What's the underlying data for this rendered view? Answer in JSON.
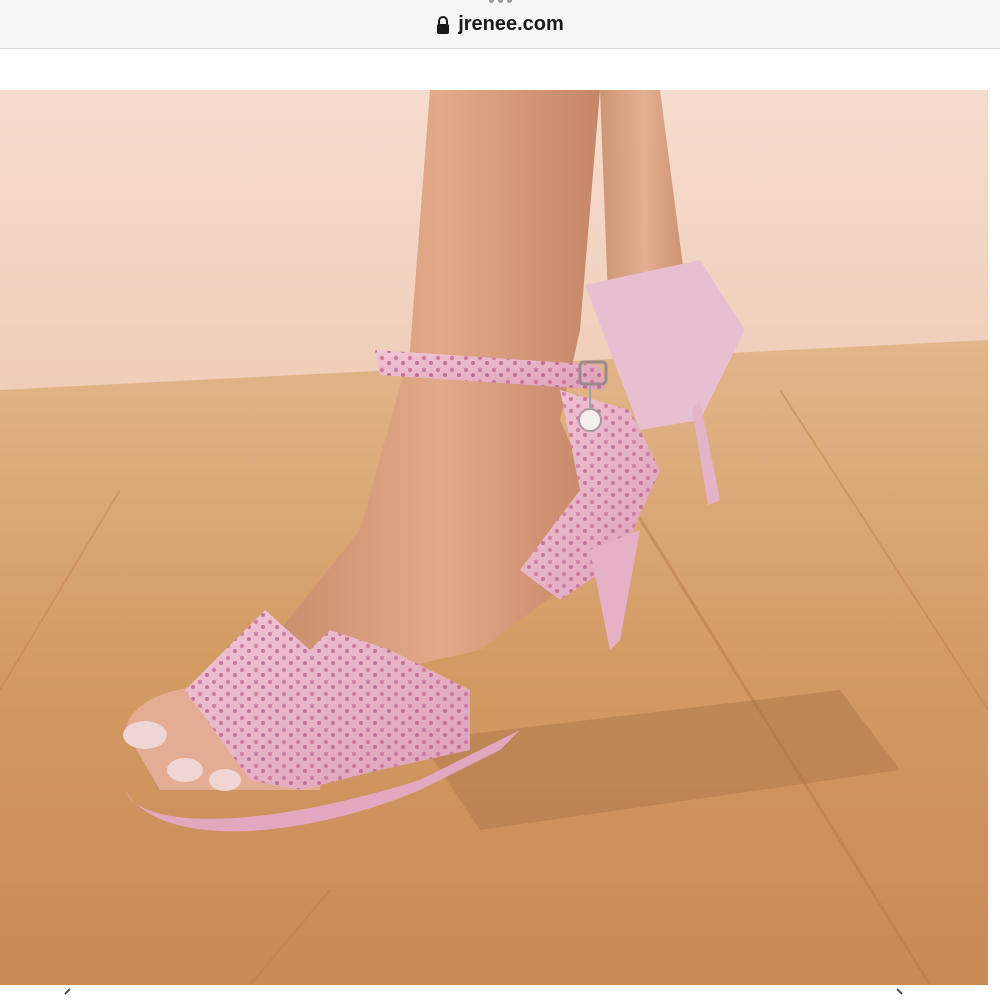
{
  "browser": {
    "url": "jrenee.com",
    "lock_icon": "lock-icon"
  },
  "photo": {
    "icon": "product-photo"
  },
  "colors": {
    "wall": "#f2d4c4",
    "floor": "#d9a26c",
    "shoe": "#e9b3c9",
    "skin": "#d9a180"
  }
}
